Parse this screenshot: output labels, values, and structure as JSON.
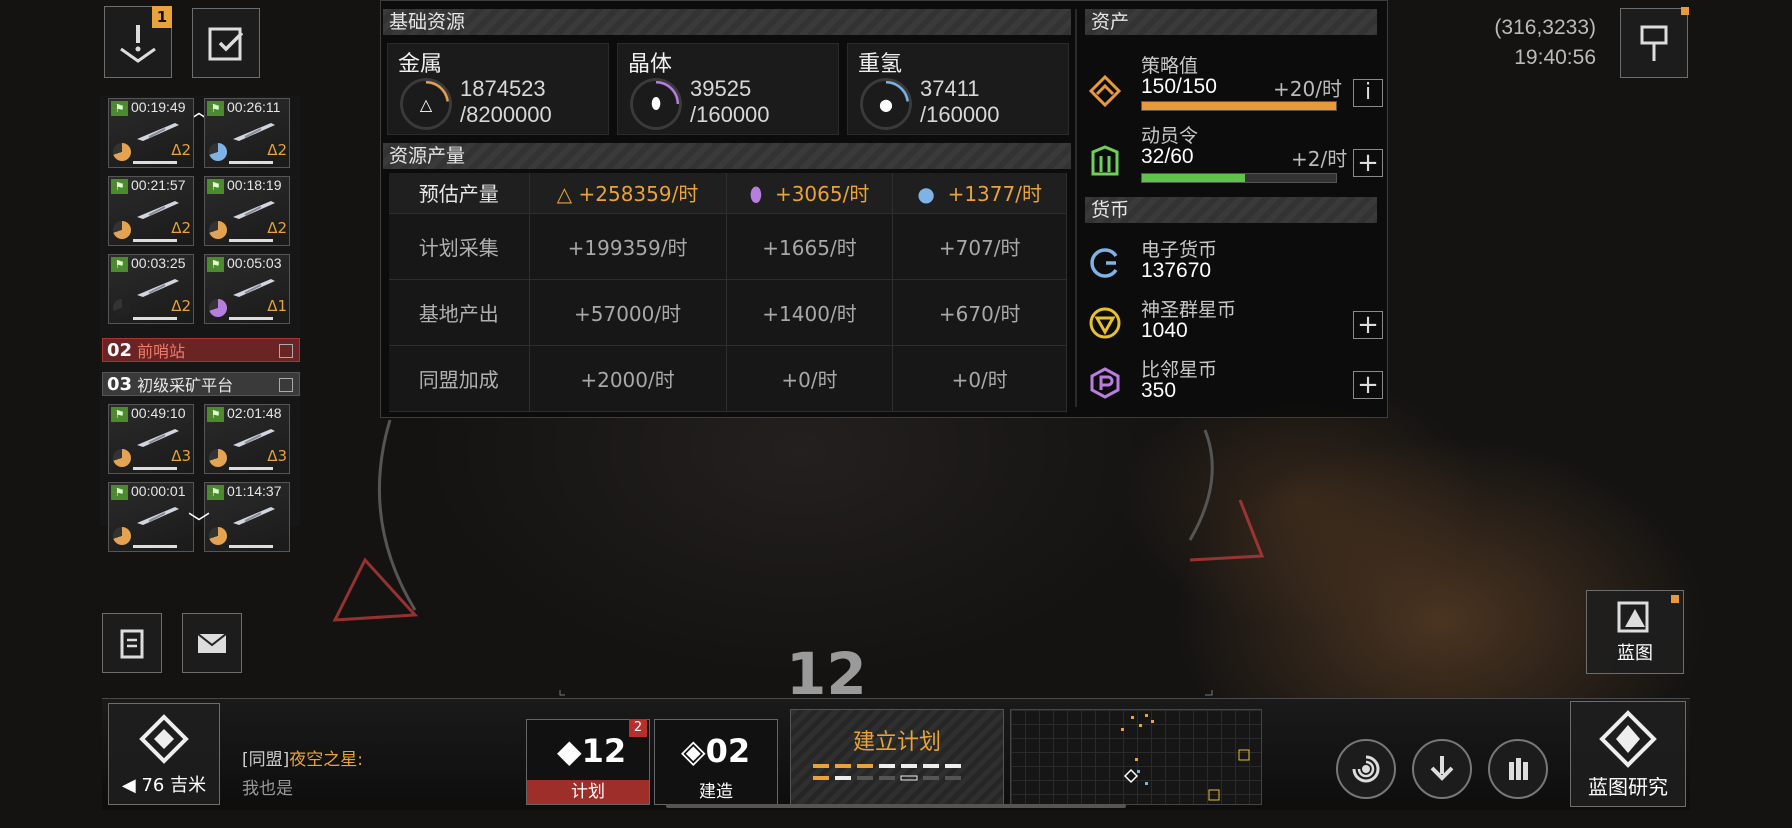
{
  "top_left": {
    "alert_badge": "1"
  },
  "fleet_queue": {
    "cards_top": [
      {
        "time": "00:19:49",
        "level": "Δ2",
        "pie_color": "#e3a352"
      },
      {
        "time": "00:26:11",
        "level": "Δ2",
        "pie_color": "#7fb3e6"
      },
      {
        "time": "00:21:57",
        "level": "Δ2",
        "pie_color": "#e3a352"
      },
      {
        "time": "00:18:19",
        "level": "Δ2",
        "pie_color": "#e3a352"
      },
      {
        "time": "00:03:25",
        "level": "Δ2",
        "pie_color": "#222222"
      },
      {
        "time": "00:05:03",
        "level": "Δ1",
        "pie_color": "#b77ee0"
      }
    ],
    "station_02": {
      "num": "02",
      "name": "前哨站"
    },
    "station_03": {
      "num": "03",
      "name": "初级采矿平台"
    },
    "cards_bottom": [
      {
        "time": "00:49:10",
        "level": "Δ3",
        "pie_color": "#e3a352"
      },
      {
        "time": "02:01:48",
        "level": "Δ3",
        "pie_color": "#e3a352"
      },
      {
        "time": "00:00:01",
        "level": "",
        "pie_color": "#e3a352"
      },
      {
        "time": "01:14:37",
        "level": "",
        "pie_color": "#e3a352"
      }
    ]
  },
  "panel": {
    "basic_title": "基础资源",
    "resources": [
      {
        "name": "金属",
        "amount": "1874523",
        "cap": "/8200000",
        "color": "#e3a352",
        "fill": 0.23
      },
      {
        "name": "晶体",
        "amount": "39525",
        "cap": "/160000",
        "color": "#b77ee0",
        "fill": 0.25
      },
      {
        "name": "重氢",
        "amount": "37411",
        "cap": "/160000",
        "color": "#7fb3e6",
        "fill": 0.23
      }
    ],
    "production_title": "资源产量",
    "production": {
      "estimate": {
        "label": "预估产量",
        "metal": "+258359/时",
        "crystal": "+3065/时",
        "deut": "+1377/时"
      },
      "rows": [
        {
          "label": "计划采集",
          "metal": "+199359/时",
          "crystal": "+1665/时",
          "deut": "+707/时"
        },
        {
          "label": "基地产出",
          "metal": "+57000/时",
          "crystal": "+1400/时",
          "deut": "+670/时"
        },
        {
          "label": "同盟加成",
          "metal": "+2000/时",
          "crystal": "+0/时",
          "deut": "+0/时"
        }
      ]
    },
    "assets_title": "资产",
    "strategy": {
      "label": "策略值",
      "value": "150/150",
      "rate": "+20/时",
      "fill": 1.0
    },
    "mobilize": {
      "label": "动员令",
      "value": "32/60",
      "rate": "+2/时",
      "fill": 0.53
    },
    "currency_title": "货币",
    "currencies": [
      {
        "label": "电子货币",
        "value": "137670"
      },
      {
        "label": "神圣群星币",
        "value": "1040"
      },
      {
        "label": "比邻星币",
        "value": "350"
      }
    ]
  },
  "top_right": {
    "coords": "(316,3233)",
    "clock": "19:40:56"
  },
  "center": {
    "marker_number": "12"
  },
  "bottom": {
    "distance": "76 吉米",
    "chat_channel": "[同盟]",
    "chat_sender": "夜空之星:",
    "chat_message": "我也是",
    "plan_count": "12",
    "plan_badge": "2",
    "plan_label": "计划",
    "build_count": "02",
    "build_label": "建造",
    "create_plan": "建立计划",
    "blueprint_label": "蓝图",
    "blueprint_research_label": "蓝图研究"
  }
}
